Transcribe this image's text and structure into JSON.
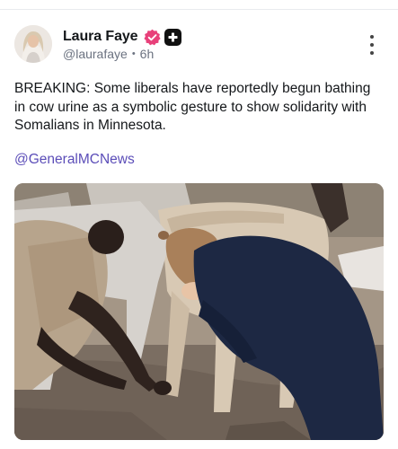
{
  "post": {
    "author": {
      "display_name": "Laura Faye",
      "handle": "@laurafaye",
      "separator": "•",
      "time_ago": "6h",
      "verified_icon": "verified-badge-icon",
      "verified_color": "#e8407a",
      "extra_badge_icon": "plus-badge-icon"
    },
    "menu_icon": "more-vertical-icon",
    "body_text": "BREAKING: Some liberals have reportedly begun bathing in cow urine as a symbolic gesture to show solidarity with Somalians in Minnesota.",
    "mention": "@GeneralMCNews",
    "mention_color": "#5b4db8",
    "media": {
      "kind": "photo"
    }
  }
}
